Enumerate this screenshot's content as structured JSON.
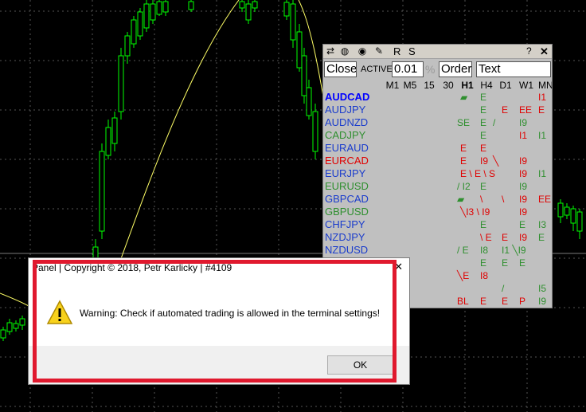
{
  "panel": {
    "title_buttons": [
      "R",
      "S"
    ],
    "title_question": "?",
    "title_close": "✕",
    "icons": [
      "panel-menu-icon",
      "globe-icon",
      "eye-icon",
      "pen-icon"
    ],
    "close_label": "Close",
    "active_label": "ACTIVE",
    "lot_value": "0.01",
    "percent_label": "%",
    "order_label": "Order",
    "text_value": "Text",
    "timeframes": [
      "M1",
      "M5",
      "15",
      "30",
      "H1",
      "H4",
      "D1",
      "W1",
      "MN"
    ],
    "active_timeframe": "H1"
  },
  "symbols": [
    {
      "name": "AUDCAD",
      "color": "#0000ff",
      "bold": true
    },
    {
      "name": "AUDJPY",
      "color": "#1a3ccc",
      "bold": false
    },
    {
      "name": "AUDNZD",
      "color": "#1a3ccc",
      "bold": false
    },
    {
      "name": "CADJPY",
      "color": "#2f8f2f",
      "bold": false
    },
    {
      "name": "EURAUD",
      "color": "#1a3ccc",
      "bold": false
    },
    {
      "name": "EURCAD",
      "color": "#e00000",
      "bold": false
    },
    {
      "name": "EURJPY",
      "color": "#1a3ccc",
      "bold": false
    },
    {
      "name": "EURUSD",
      "color": "#2f8f2f",
      "bold": false
    },
    {
      "name": "GBPCAD",
      "color": "#1a3ccc",
      "bold": false
    },
    {
      "name": "GBPUSD",
      "color": "#2f8f2f",
      "bold": false
    },
    {
      "name": "CHFJPY",
      "color": "#1a3ccc",
      "bold": false
    },
    {
      "name": "NZDJPY",
      "color": "#1a3ccc",
      "bold": false
    },
    {
      "name": "NZDUSD",
      "color": "#1a3ccc",
      "bold": false
    }
  ],
  "signals": [
    {
      "row": 0,
      "col": "H1",
      "text": "▰",
      "color": "#2f8f2f"
    },
    {
      "row": 0,
      "col": "H4",
      "text": "E",
      "color": "#2f8f2f"
    },
    {
      "row": 0,
      "col": "MN",
      "text": "I1",
      "color": "#e00000"
    },
    {
      "row": 1,
      "col": "H4",
      "text": "E",
      "color": "#2f8f2f"
    },
    {
      "row": 1,
      "col": "D1",
      "text": "E",
      "color": "#e00000"
    },
    {
      "row": 1,
      "col": "W1",
      "text": "EE",
      "color": "#e00000"
    },
    {
      "row": 1,
      "col": "MN",
      "text": "E",
      "color": "#e00000"
    },
    {
      "row": 2,
      "col": "30",
      "text": "SE",
      "color": "#2f8f2f"
    },
    {
      "row": 2,
      "col": "H4",
      "text": "E",
      "color": "#2f8f2f"
    },
    {
      "row": 2,
      "col": "H4b",
      "text": "/",
      "color": "#2f8f2f"
    },
    {
      "row": 2,
      "col": "W1",
      "text": "I9",
      "color": "#2f8f2f"
    },
    {
      "row": 3,
      "col": "H4",
      "text": "E",
      "color": "#2f8f2f"
    },
    {
      "row": 3,
      "col": "W1",
      "text": "I1",
      "color": "#e00000"
    },
    {
      "row": 3,
      "col": "MN",
      "text": "I1",
      "color": "#2f8f2f"
    },
    {
      "row": 4,
      "col": "H1",
      "text": "E",
      "color": "#e00000"
    },
    {
      "row": 4,
      "col": "H4",
      "text": "E",
      "color": "#e00000"
    },
    {
      "row": 5,
      "col": "H1",
      "text": "E",
      "color": "#e00000"
    },
    {
      "row": 5,
      "col": "H4",
      "text": "I9",
      "color": "#e00000"
    },
    {
      "row": 5,
      "col": "H4b",
      "text": "╲",
      "color": "#e00000"
    },
    {
      "row": 5,
      "col": "W1",
      "text": "I9",
      "color": "#e00000"
    },
    {
      "row": 6,
      "col": "H1",
      "text": "E \\ E \\ S",
      "color": "#e00000"
    },
    {
      "row": 6,
      "col": "W1",
      "text": "I9",
      "color": "#e00000"
    },
    {
      "row": 6,
      "col": "MN",
      "text": "I1",
      "color": "#2f8f2f"
    },
    {
      "row": 7,
      "col": "30",
      "text": "/ I2",
      "color": "#2f8f2f"
    },
    {
      "row": 7,
      "col": "H4",
      "text": "E",
      "color": "#2f8f2f"
    },
    {
      "row": 7,
      "col": "W1",
      "text": "I9",
      "color": "#2f8f2f"
    },
    {
      "row": 8,
      "col": "30",
      "text": "▰",
      "color": "#2f8f2f"
    },
    {
      "row": 8,
      "col": "H4",
      "text": "\\",
      "color": "#e00000"
    },
    {
      "row": 8,
      "col": "D1",
      "text": "\\",
      "color": "#e00000"
    },
    {
      "row": 8,
      "col": "W1",
      "text": "I9",
      "color": "#e00000"
    },
    {
      "row": 8,
      "col": "MN",
      "text": "EE",
      "color": "#e00000"
    },
    {
      "row": 9,
      "col": "H1",
      "text": "╲I3 \\ I9",
      "color": "#e00000"
    },
    {
      "row": 9,
      "col": "W1",
      "text": "I9",
      "color": "#e00000"
    },
    {
      "row": 10,
      "col": "H4",
      "text": "E",
      "color": "#2f8f2f"
    },
    {
      "row": 10,
      "col": "W1",
      "text": "E",
      "color": "#2f8f2f"
    },
    {
      "row": 10,
      "col": "MN",
      "text": "I3",
      "color": "#2f8f2f"
    },
    {
      "row": 11,
      "col": "H4",
      "text": "\\ E",
      "color": "#e00000"
    },
    {
      "row": 11,
      "col": "D1",
      "text": "E",
      "color": "#e00000"
    },
    {
      "row": 11,
      "col": "W1",
      "text": "I9",
      "color": "#e00000"
    },
    {
      "row": 11,
      "col": "MN",
      "text": "E",
      "color": "#2f8f2f"
    },
    {
      "row": 12,
      "col": "30",
      "text": "/ E",
      "color": "#2f8f2f"
    },
    {
      "row": 12,
      "col": "H4",
      "text": "I8",
      "color": "#2f8f2f"
    },
    {
      "row": 12,
      "col": "D1",
      "text": "I1 ╲I9",
      "color": "#2f8f2f"
    },
    {
      "row": 13,
      "col": "H4",
      "text": "E",
      "color": "#2f8f2f"
    },
    {
      "row": 13,
      "col": "D1",
      "text": "E",
      "color": "#2f8f2f"
    },
    {
      "row": 13,
      "col": "W1",
      "text": "E",
      "color": "#2f8f2f"
    },
    {
      "row": 14,
      "col": "30",
      "text": "╲E",
      "color": "#e00000"
    },
    {
      "row": 14,
      "col": "H4",
      "text": "I8",
      "color": "#e00000"
    },
    {
      "row": 15,
      "col": "D1",
      "text": "/",
      "color": "#2f8f2f"
    },
    {
      "row": 15,
      "col": "MN",
      "text": "I5",
      "color": "#2f8f2f"
    },
    {
      "row": 16,
      "col": "30",
      "text": "BL",
      "color": "#e00000"
    },
    {
      "row": 16,
      "col": "H4",
      "text": "E",
      "color": "#e00000"
    },
    {
      "row": 16,
      "col": "D1",
      "text": "E",
      "color": "#e00000"
    },
    {
      "row": 16,
      "col": "W1",
      "text": "P",
      "color": "#e00000"
    },
    {
      "row": 16,
      "col": "MN",
      "text": "I9",
      "color": "#2f8f2f"
    }
  ],
  "dialog": {
    "title": "Panel | Copyright © 2018, Petr Karlicky | #4109",
    "close": "✕",
    "message": "Warning: Check if automated trading is allowed in the terminal settings!",
    "ok_label": "OK"
  },
  "colors": {
    "chart_bg": "#000000",
    "candle": "#00ff00",
    "ma_line": "#ffff66",
    "grid": "#555555",
    "highlight": "#e0192e"
  }
}
